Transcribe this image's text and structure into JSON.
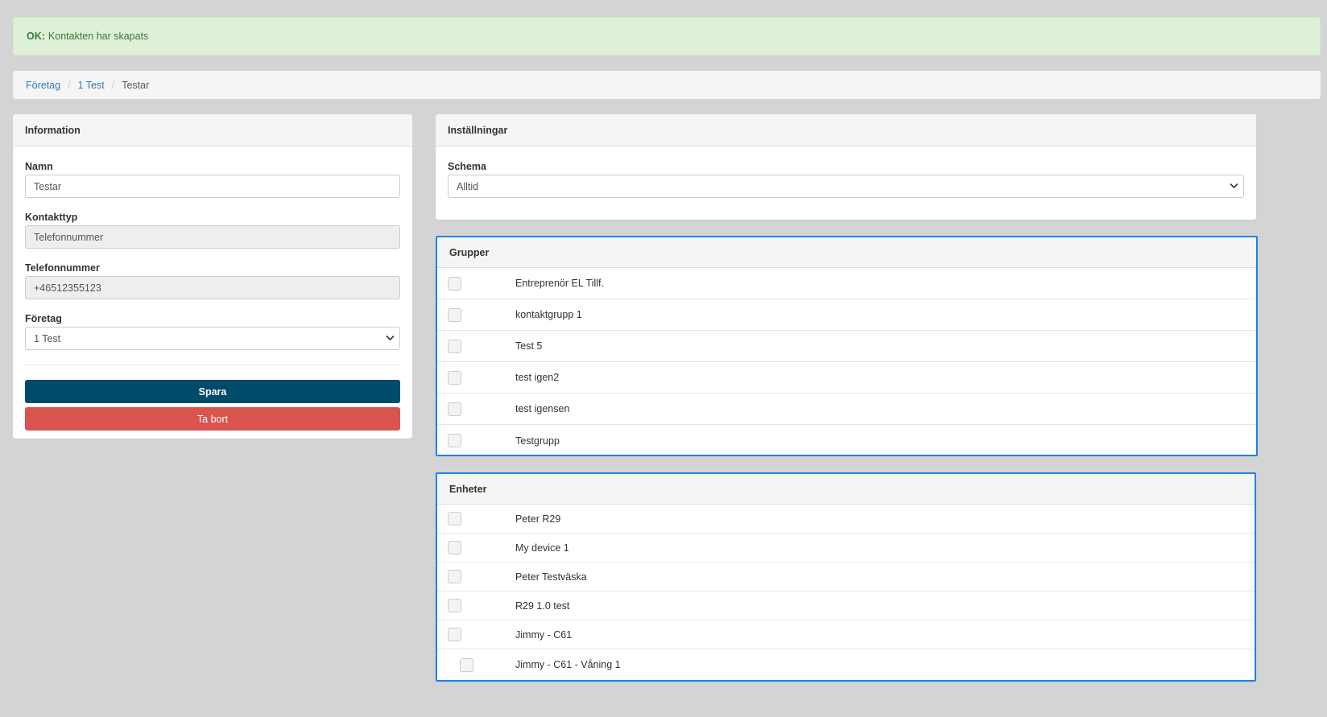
{
  "alert": {
    "prefix": "OK:",
    "message": "Kontakten har skapats"
  },
  "breadcrumb": [
    {
      "label": "Företag"
    },
    {
      "label": "1 Test"
    },
    {
      "label": "Testar"
    }
  ],
  "information": {
    "title": "Information",
    "name_label": "Namn",
    "name_value": "Testar",
    "type_label": "Kontakttyp",
    "type_value": "Telefonnummer",
    "phone_label": "Telefonnummer",
    "phone_value": "+46512355123",
    "company_label": "Företag",
    "company_value": "1 Test",
    "save_label": "Spara",
    "delete_label": "Ta bort"
  },
  "settings": {
    "title": "Inställningar",
    "schema_label": "Schema",
    "schema_value": "Alltid"
  },
  "groups": {
    "title": "Grupper",
    "items": [
      {
        "label": "Entreprenör EL Tillf.",
        "checked": false
      },
      {
        "label": "kontaktgrupp 1",
        "checked": false
      },
      {
        "label": "Test 5",
        "checked": false
      },
      {
        "label": "test igen2",
        "checked": false
      },
      {
        "label": "test igensen",
        "checked": false
      },
      {
        "label": "Testgrupp",
        "checked": false
      }
    ]
  },
  "units": {
    "title": "Enheter",
    "items": [
      {
        "label": "Peter R29",
        "checked": false
      },
      {
        "label": "My device 1",
        "checked": false
      },
      {
        "label": "Peter Testväska",
        "checked": false
      },
      {
        "label": "R29 1.0 test",
        "checked": false
      },
      {
        "label": "Jimmy - C61",
        "checked": false
      },
      {
        "label": "Jimmy - C61 - Våning 1",
        "checked": false
      }
    ]
  },
  "colors": {
    "alert_bg": "#dff0d8",
    "primary": "#004a6c",
    "danger": "#d9534f",
    "highlight_border": "#1f82ec",
    "link": "#337ab7"
  },
  "icons": {
    "select_caret": "chevron-down-icon"
  }
}
